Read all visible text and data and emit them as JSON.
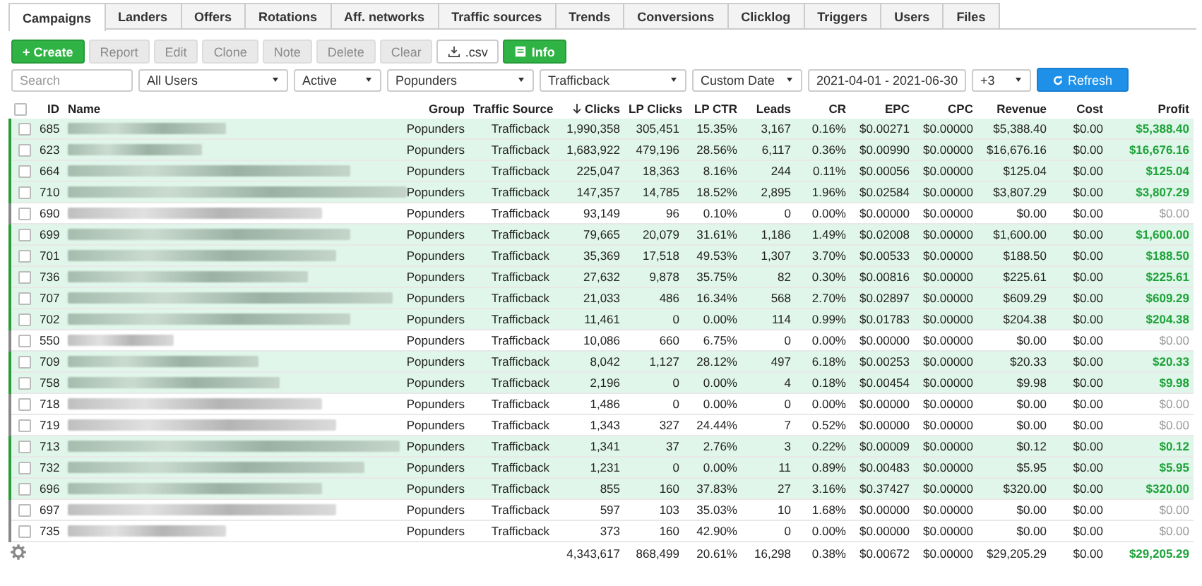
{
  "tabs": [
    {
      "label": "Campaigns",
      "selected": true
    },
    {
      "label": "Landers",
      "selected": false
    },
    {
      "label": "Offers",
      "selected": false
    },
    {
      "label": "Rotations",
      "selected": false
    },
    {
      "label": "Aff. networks",
      "selected": false
    },
    {
      "label": "Traffic sources",
      "selected": false
    },
    {
      "label": "Trends",
      "selected": false
    },
    {
      "label": "Conversions",
      "selected": false
    },
    {
      "label": "Clicklog",
      "selected": false
    },
    {
      "label": "Triggers",
      "selected": false
    },
    {
      "label": "Users",
      "selected": false
    },
    {
      "label": "Files",
      "selected": false
    }
  ],
  "toolbar": [
    {
      "kind": "create",
      "label": "+ Create",
      "disabled": false
    },
    {
      "kind": "report",
      "label": "Report",
      "disabled": true
    },
    {
      "kind": "edit",
      "label": "Edit",
      "disabled": true
    },
    {
      "kind": "clone",
      "label": "Clone",
      "disabled": true
    },
    {
      "kind": "note",
      "label": "Note",
      "disabled": true
    },
    {
      "kind": "delete",
      "label": "Delete",
      "disabled": true
    },
    {
      "kind": "clear",
      "label": "Clear",
      "disabled": true
    },
    {
      "kind": "csv",
      "label": ".csv",
      "disabled": false
    },
    {
      "kind": "info",
      "label": "Info",
      "disabled": false
    }
  ],
  "filters": {
    "search": {
      "placeholder": "Search"
    },
    "users": "All Users",
    "status": "Active",
    "group": "Popunders",
    "traffic_source": "Trafficback",
    "date_mode": "Custom Date",
    "date_range": "2021-04-01 - 2021-06-30",
    "extra": "+3",
    "refresh": "Refresh"
  },
  "table": {
    "select_all_checked": false,
    "columns": [
      {
        "label": "ID",
        "sorted": false
      },
      {
        "label": "Name",
        "sorted": false
      },
      {
        "label": "Group",
        "sorted": false
      },
      {
        "label": "Traffic Source",
        "sorted": false
      },
      {
        "label": "Clicks",
        "sorted": true
      },
      {
        "label": "LP Clicks",
        "sorted": false
      },
      {
        "label": "LP CTR",
        "sorted": false
      },
      {
        "label": "Leads",
        "sorted": false
      },
      {
        "label": "CR",
        "sorted": false
      },
      {
        "label": "EPC",
        "sorted": false
      },
      {
        "label": "CPC",
        "sorted": false
      },
      {
        "label": "Revenue",
        "sorted": false
      },
      {
        "label": "Cost",
        "sorted": false
      },
      {
        "label": "Profit",
        "sorted": false
      }
    ],
    "rows": [
      {
        "checked": false,
        "highlighted": true,
        "cells": [
          "685",
          "",
          "Popunders",
          "Trafficback",
          "1,990,358",
          "305,451",
          "15.35%",
          "3,167",
          "0.16%",
          "$0.00271",
          "$0.00000",
          "$5,388.40",
          "$0.00",
          "$5,388.40"
        ]
      },
      {
        "checked": false,
        "highlighted": true,
        "cells": [
          "623",
          "",
          "Popunders",
          "Trafficback",
          "1,683,922",
          "479,196",
          "28.56%",
          "6,117",
          "0.36%",
          "$0.00990",
          "$0.00000",
          "$16,676.16",
          "$0.00",
          "$16,676.16"
        ]
      },
      {
        "checked": false,
        "highlighted": true,
        "cells": [
          "664",
          "",
          "Popunders",
          "Trafficback",
          "225,047",
          "18,363",
          "8.16%",
          "244",
          "0.11%",
          "$0.00056",
          "$0.00000",
          "$125.04",
          "$0.00",
          "$125.04"
        ]
      },
      {
        "checked": false,
        "highlighted": true,
        "cells": [
          "710",
          "",
          "Popunders",
          "Trafficback",
          "147,357",
          "14,785",
          "18.52%",
          "2,895",
          "1.96%",
          "$0.02584",
          "$0.00000",
          "$3,807.29",
          "$0.00",
          "$3,807.29"
        ]
      },
      {
        "checked": false,
        "highlighted": false,
        "cells": [
          "690",
          "",
          "Popunders",
          "Trafficback",
          "93,149",
          "96",
          "0.10%",
          "0",
          "0.00%",
          "$0.00000",
          "$0.00000",
          "$0.00",
          "$0.00",
          "$0.00"
        ]
      },
      {
        "checked": false,
        "highlighted": true,
        "cells": [
          "699",
          "",
          "Popunders",
          "Trafficback",
          "79,665",
          "20,079",
          "31.61%",
          "1,186",
          "1.49%",
          "$0.02008",
          "$0.00000",
          "$1,600.00",
          "$0.00",
          "$1,600.00"
        ]
      },
      {
        "checked": false,
        "highlighted": true,
        "cells": [
          "701",
          "",
          "Popunders",
          "Trafficback",
          "35,369",
          "17,518",
          "49.53%",
          "1,307",
          "3.70%",
          "$0.00533",
          "$0.00000",
          "$188.50",
          "$0.00",
          "$188.50"
        ]
      },
      {
        "checked": false,
        "highlighted": true,
        "cells": [
          "736",
          "",
          "Popunders",
          "Trafficback",
          "27,632",
          "9,878",
          "35.75%",
          "82",
          "0.30%",
          "$0.00816",
          "$0.00000",
          "$225.61",
          "$0.00",
          "$225.61"
        ]
      },
      {
        "checked": false,
        "highlighted": true,
        "cells": [
          "707",
          "",
          "Popunders",
          "Trafficback",
          "21,033",
          "486",
          "16.34%",
          "568",
          "2.70%",
          "$0.02897",
          "$0.00000",
          "$609.29",
          "$0.00",
          "$609.29"
        ]
      },
      {
        "checked": false,
        "highlighted": true,
        "cells": [
          "702",
          "",
          "Popunders",
          "Trafficback",
          "11,461",
          "0",
          "0.00%",
          "114",
          "0.99%",
          "$0.01783",
          "$0.00000",
          "$204.38",
          "$0.00",
          "$204.38"
        ]
      },
      {
        "checked": false,
        "highlighted": false,
        "cells": [
          "550",
          "",
          "Popunders",
          "Trafficback",
          "10,086",
          "660",
          "6.75%",
          "0",
          "0.00%",
          "$0.00000",
          "$0.00000",
          "$0.00",
          "$0.00",
          "$0.00"
        ]
      },
      {
        "checked": false,
        "highlighted": true,
        "cells": [
          "709",
          "",
          "Popunders",
          "Trafficback",
          "8,042",
          "1,127",
          "28.12%",
          "497",
          "6.18%",
          "$0.00253",
          "$0.00000",
          "$20.33",
          "$0.00",
          "$20.33"
        ]
      },
      {
        "checked": false,
        "highlighted": true,
        "cells": [
          "758",
          "",
          "Popunders",
          "Trafficback",
          "2,196",
          "0",
          "0.00%",
          "4",
          "0.18%",
          "$0.00454",
          "$0.00000",
          "$9.98",
          "$0.00",
          "$9.98"
        ]
      },
      {
        "checked": false,
        "highlighted": false,
        "cells": [
          "718",
          "",
          "Popunders",
          "Trafficback",
          "1,486",
          "0",
          "0.00%",
          "0",
          "0.00%",
          "$0.00000",
          "$0.00000",
          "$0.00",
          "$0.00",
          "$0.00"
        ]
      },
      {
        "checked": false,
        "highlighted": false,
        "cells": [
          "719",
          "",
          "Popunders",
          "Trafficback",
          "1,343",
          "327",
          "24.44%",
          "7",
          "0.52%",
          "$0.00000",
          "$0.00000",
          "$0.00",
          "$0.00",
          "$0.00"
        ]
      },
      {
        "checked": false,
        "highlighted": true,
        "cells": [
          "713",
          "",
          "Popunders",
          "Trafficback",
          "1,341",
          "37",
          "2.76%",
          "3",
          "0.22%",
          "$0.00009",
          "$0.00000",
          "$0.12",
          "$0.00",
          "$0.12"
        ]
      },
      {
        "checked": false,
        "highlighted": true,
        "cells": [
          "732",
          "",
          "Popunders",
          "Trafficback",
          "1,231",
          "0",
          "0.00%",
          "11",
          "0.89%",
          "$0.00483",
          "$0.00000",
          "$5.95",
          "$0.00",
          "$5.95"
        ]
      },
      {
        "checked": false,
        "highlighted": true,
        "cells": [
          "696",
          "",
          "Popunders",
          "Trafficback",
          "855",
          "160",
          "37.83%",
          "27",
          "3.16%",
          "$0.37427",
          "$0.00000",
          "$320.00",
          "$0.00",
          "$320.00"
        ]
      },
      {
        "checked": false,
        "highlighted": false,
        "cells": [
          "697",
          "",
          "Popunders",
          "Trafficback",
          "597",
          "103",
          "35.03%",
          "10",
          "1.68%",
          "$0.00000",
          "$0.00000",
          "$0.00",
          "$0.00",
          "$0.00"
        ]
      },
      {
        "checked": false,
        "highlighted": false,
        "cells": [
          "735",
          "",
          "Popunders",
          "Trafficback",
          "373",
          "160",
          "42.90%",
          "0",
          "0.00%",
          "$0.00000",
          "$0.00000",
          "$0.00",
          "$0.00",
          "$0.00"
        ]
      }
    ],
    "totals": [
      "4,343,617",
      "868,499",
      "20.61%",
      "16,298",
      "0.38%",
      "$0.00672",
      "$0.00000",
      "$29,205.29",
      "$0.00",
      "$29,205.29"
    ]
  }
}
